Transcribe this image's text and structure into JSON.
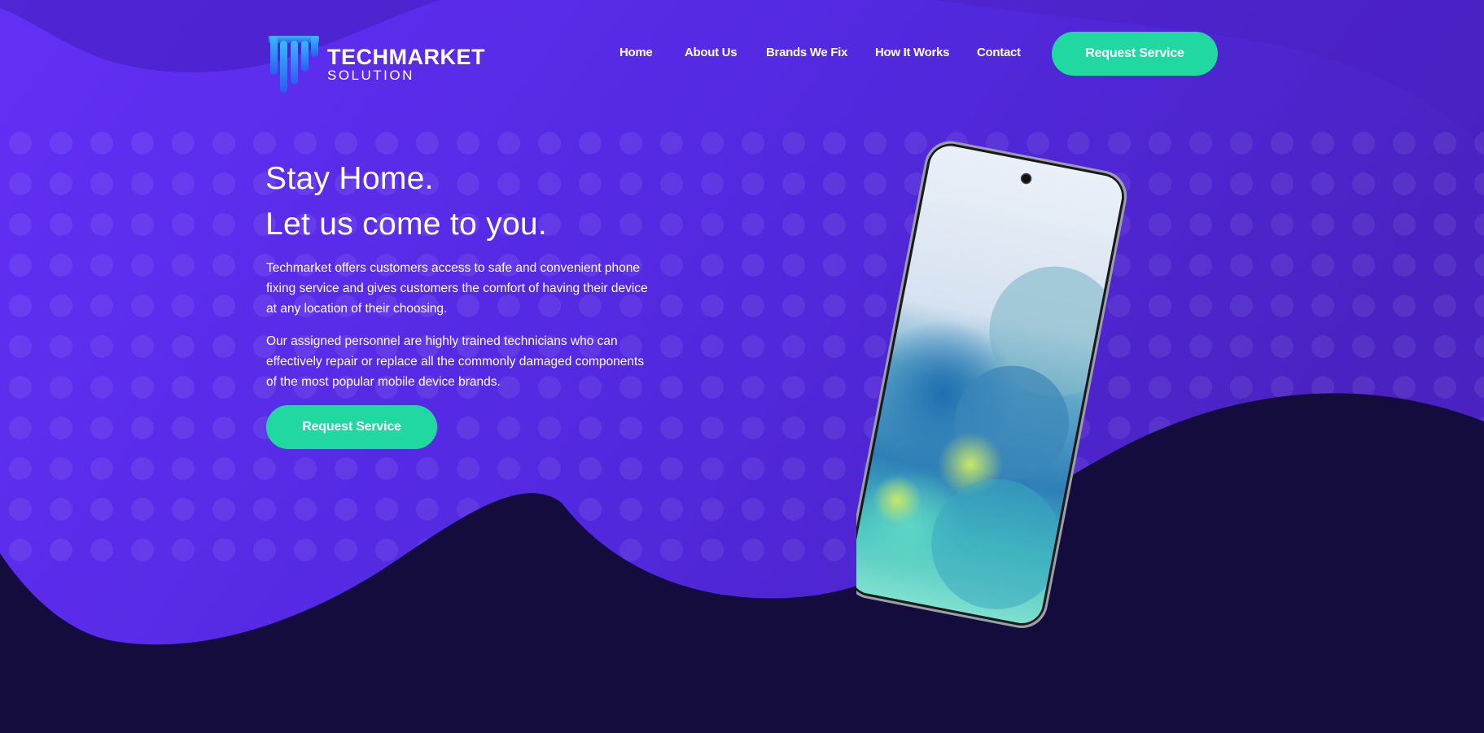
{
  "brand": {
    "name": "TECHMARKET",
    "tagline": "SOLUTION"
  },
  "nav": {
    "items": [
      {
        "label": "Home"
      },
      {
        "label": "About Us"
      },
      {
        "label": "Brands We Fix"
      },
      {
        "label": "How It Works"
      },
      {
        "label": "Contact"
      }
    ],
    "cta_label": "Request Service"
  },
  "hero": {
    "title_line_1": "Stay Home.",
    "title_line_2": "Let us come to you.",
    "paragraph_1": "Techmarket offers customers access to safe and convenient phone fixing service and gives customers the comfort of having their device at any location of their choosing.",
    "paragraph_2": "Our assigned personnel are highly trained technicians who can effectively repair or replace all the commonly damaged components of the most popular mobile device brands.",
    "cta_label": "Request Service"
  },
  "colors": {
    "hero_purple": "#5a2ef0",
    "hero_purple_dark": "#3d1fb0",
    "footer_navy": "#140c3c",
    "accent_green": "#20d8a0",
    "text_white": "#ffffff"
  }
}
